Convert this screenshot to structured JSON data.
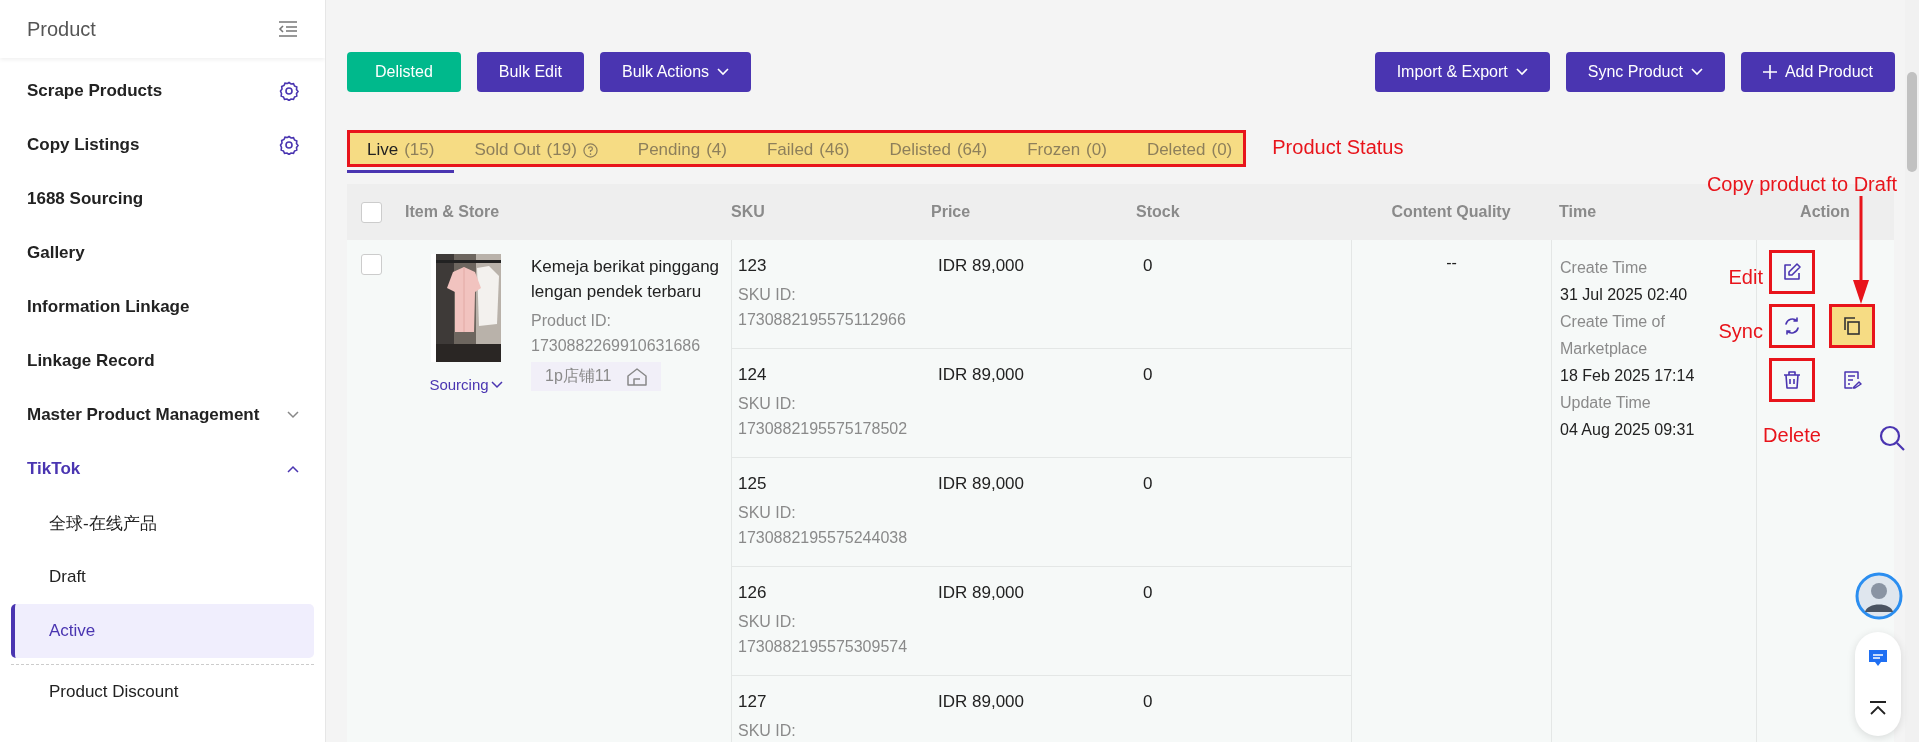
{
  "sidebar": {
    "title": "Product",
    "items": [
      {
        "label": "Scrape Products",
        "kind": "settings"
      },
      {
        "label": "Copy Listings",
        "kind": "settings"
      },
      {
        "label": "1688 Sourcing",
        "kind": "plain"
      },
      {
        "label": "Gallery",
        "kind": "plain"
      },
      {
        "label": "Information Linkage",
        "kind": "plain"
      },
      {
        "label": "Linkage Record",
        "kind": "plain"
      },
      {
        "label": "Master Product Management",
        "kind": "group",
        "expanded": false
      },
      {
        "label": "TikTok",
        "kind": "group",
        "expanded": true,
        "children": [
          {
            "label": "全球-在线产品",
            "selected": false
          },
          {
            "label": "Draft",
            "selected": false
          },
          {
            "label": "Active",
            "selected": true
          }
        ]
      },
      {
        "label": "Product Discount",
        "kind": "sub",
        "selected": false
      }
    ]
  },
  "toolbar": {
    "left": [
      {
        "label": "Delisted",
        "kind": "success"
      },
      {
        "label": "Bulk Edit",
        "kind": "primary"
      },
      {
        "label": "Bulk Actions",
        "kind": "dropdown"
      }
    ],
    "right": [
      {
        "label": "Import & Export",
        "kind": "dropdown"
      },
      {
        "label": "Sync Product",
        "kind": "dropdown"
      },
      {
        "label": "Add Product",
        "kind": "add"
      }
    ]
  },
  "status_tabs": {
    "annotation": "Product Status",
    "tabs": [
      {
        "label": "Live",
        "count": "(15)",
        "selected": true,
        "help": false
      },
      {
        "label": "Sold Out",
        "count": "(19)",
        "selected": false,
        "help": true
      },
      {
        "label": "Pending",
        "count": "(4)",
        "selected": false,
        "help": false
      },
      {
        "label": "Failed",
        "count": "(46)",
        "selected": false,
        "help": false
      },
      {
        "label": "Delisted",
        "count": "(64)",
        "selected": false,
        "help": false
      },
      {
        "label": "Frozen",
        "count": "(0)",
        "selected": false,
        "help": false
      },
      {
        "label": "Deleted",
        "count": "(0)",
        "selected": false,
        "help": false
      }
    ]
  },
  "table": {
    "select_all": {
      "checked": false
    },
    "columns": [
      "Item & Store",
      "SKU",
      "Price",
      "Stock",
      "Content Quality",
      "Time",
      "Action"
    ],
    "rows": [
      {
        "checked": false,
        "title": "Kemeja berikat pinggang lengan pendek terbaru",
        "product_id_label": "Product ID:",
        "product_id": "1730882269910631686",
        "store": "1p店铺11",
        "sourcing": "Sourcing",
        "skus": [
          {
            "sku": "123",
            "sku_id_label": "SKU ID:",
            "sku_id": "1730882195575112966",
            "price": "IDR 89,000",
            "stock": "0"
          },
          {
            "sku": "124",
            "sku_id_label": "SKU ID:",
            "sku_id": "1730882195575178502",
            "price": "IDR 89,000",
            "stock": "0"
          },
          {
            "sku": "125",
            "sku_id_label": "SKU ID:",
            "sku_id": "1730882195575244038",
            "price": "IDR 89,000",
            "stock": "0"
          },
          {
            "sku": "126",
            "sku_id_label": "SKU ID:",
            "sku_id": "1730882195575309574",
            "price": "IDR 89,000",
            "stock": "0"
          },
          {
            "sku": "127",
            "sku_id_label": "SKU ID:",
            "price": "IDR 89,000",
            "stock": "0"
          }
        ],
        "content_quality": "--",
        "times": [
          {
            "label": "Create Time",
            "value": "31 Jul 2025 02:40"
          },
          {
            "label": "Create Time of Marketplace",
            "value": "18 Feb 2025 17:14"
          },
          {
            "label": "Update Time",
            "value": "04 Aug 2025 09:31"
          }
        ],
        "actions": [
          {
            "kind": "edit",
            "annotated": true,
            "highlighted": false
          },
          {
            "kind": "sync",
            "annotated": true,
            "highlighted": false
          },
          {
            "kind": "copy",
            "annotated": true,
            "highlighted": true
          },
          {
            "kind": "delete",
            "annotated": true,
            "highlighted": false
          },
          {
            "kind": "notes",
            "annotated": false,
            "highlighted": false
          }
        ],
        "annotations": [
          {
            "kind": "copy",
            "text": "Copy product to Draft"
          },
          {
            "kind": "edit",
            "text": "Edit"
          },
          {
            "kind": "sync",
            "text": "Sync"
          },
          {
            "kind": "delete",
            "text": "Delete"
          }
        ]
      }
    ]
  }
}
